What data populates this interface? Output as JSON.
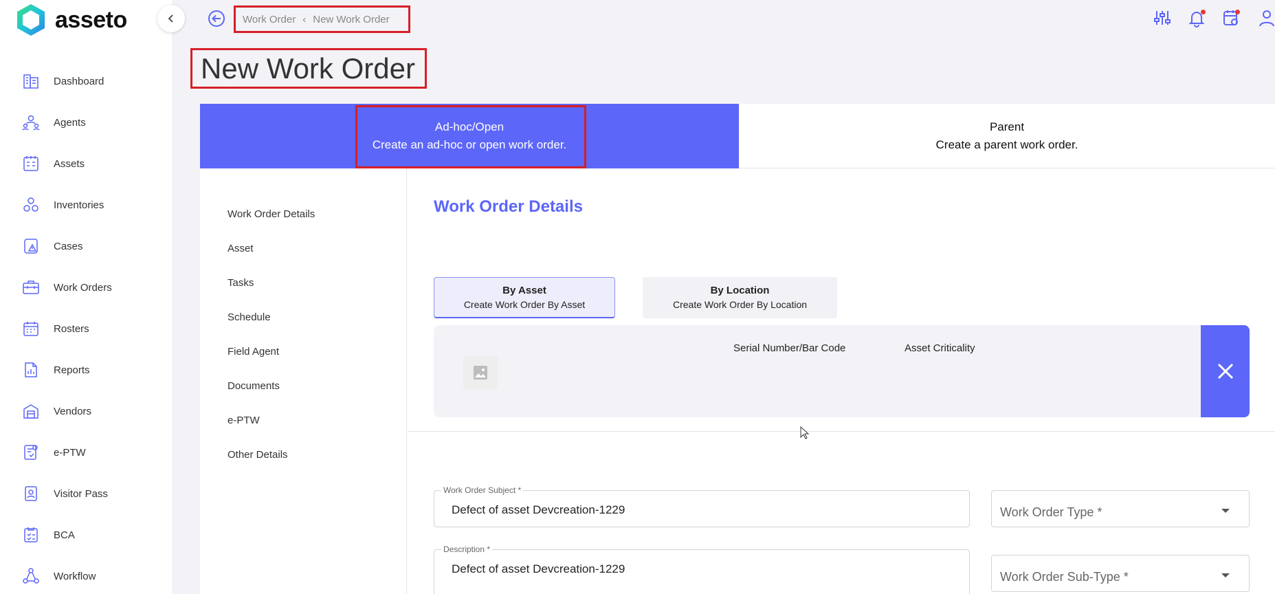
{
  "app": {
    "name": "asseto"
  },
  "sidebar": {
    "items": [
      {
        "label": "Dashboard",
        "icon": "dashboard-icon"
      },
      {
        "label": "Agents",
        "icon": "agents-icon"
      },
      {
        "label": "Assets",
        "icon": "assets-icon"
      },
      {
        "label": "Inventories",
        "icon": "inventories-icon"
      },
      {
        "label": "Cases",
        "icon": "cases-icon"
      },
      {
        "label": "Work Orders",
        "icon": "work-orders-icon"
      },
      {
        "label": "Rosters",
        "icon": "rosters-icon"
      },
      {
        "label": "Reports",
        "icon": "reports-icon"
      },
      {
        "label": "Vendors",
        "icon": "vendors-icon"
      },
      {
        "label": "e-PTW",
        "icon": "eptw-icon"
      },
      {
        "label": "Visitor Pass",
        "icon": "visitor-pass-icon"
      },
      {
        "label": "BCA",
        "icon": "bca-icon"
      },
      {
        "label": "Workflow",
        "icon": "workflow-icon"
      }
    ]
  },
  "header": {
    "breadcrumb": [
      "Work Order",
      "New Work Order"
    ],
    "icons": [
      "filter-sliders-icon",
      "notification-bell-icon",
      "task-calendar-icon",
      "user-profile-icon"
    ]
  },
  "page": {
    "title": "New Work Order"
  },
  "type_tabs": [
    {
      "title": "Ad-hoc/Open",
      "subtitle": "Create an ad-hoc or open work order.",
      "active": true
    },
    {
      "title": "Parent",
      "subtitle": "Create a parent work order.",
      "active": false
    }
  ],
  "section_nav": [
    "Work Order Details",
    "Asset",
    "Tasks",
    "Schedule",
    "Field Agent",
    "Documents",
    "e-PTW",
    "Other Details"
  ],
  "details": {
    "title": "Work Order Details",
    "mode_tabs": [
      {
        "title": "By Asset",
        "subtitle": "Create Work Order By Asset",
        "active": true
      },
      {
        "title": "By Location",
        "subtitle": "Create Work Order By Location",
        "active": false
      }
    ],
    "asset_card": {
      "columns": [
        "Serial Number/Bar Code",
        "Asset Criticality"
      ]
    },
    "fields": {
      "subject": {
        "label": "Work Order Subject *",
        "value": "Defect of asset Devcreation-1229"
      },
      "description": {
        "label": "Description *",
        "value": "Defect of asset Devcreation-1229"
      },
      "type": {
        "placeholder": "Work Order Type *"
      },
      "sub_type": {
        "placeholder": "Work Order Sub-Type *"
      }
    }
  },
  "colors": {
    "accent": "#5c66f8",
    "highlight": "#d61f26",
    "background": "#f3f2f7"
  }
}
